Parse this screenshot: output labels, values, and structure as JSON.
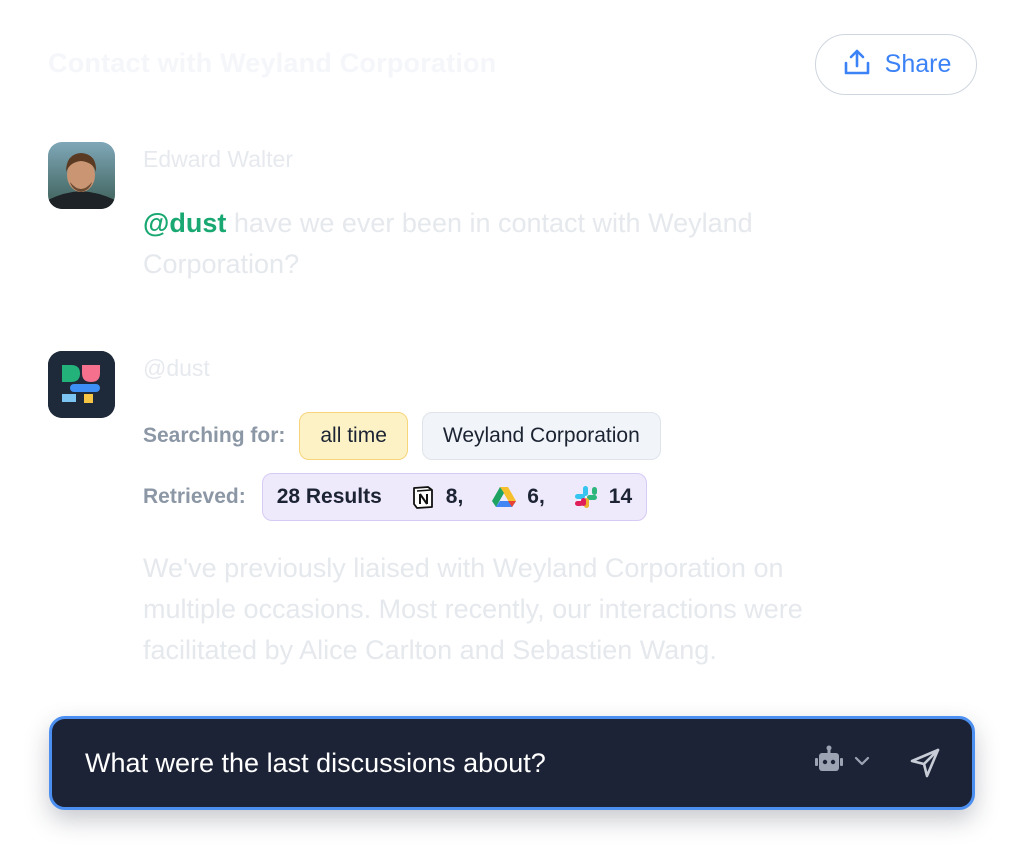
{
  "header": {
    "title": "Contact with Weyland  Corporation",
    "share_label": "Share"
  },
  "conversation": {
    "user_message": {
      "author": "Edward Walter",
      "mention": "@dust",
      "text": " have we ever been in contact with Weyland Corporation?"
    },
    "assistant_message": {
      "author": "@dust",
      "searching_label": "Searching for:",
      "search_chips": [
        "all time",
        "Weyland Corporation"
      ],
      "retrieved_label": "Retrieved:",
      "results_total": "28 Results",
      "sources": [
        {
          "icon": "notion-icon",
          "count": "8,"
        },
        {
          "icon": "google-drive-icon",
          "count": "6,"
        },
        {
          "icon": "slack-icon",
          "count": "14"
        }
      ],
      "answer": "We've previously liaised with Weyland Corporation on multiple occasions. Most recently, our interactions were facilitated by Alice Carlton and Sebastien Wang."
    }
  },
  "composer": {
    "input_value": "What were the last discussions about?",
    "agent_icon": "robot-icon",
    "send_icon": "send-icon"
  },
  "colors": {
    "accent": "#3b82f6",
    "mention": "#1aa872",
    "composer_bg": "#1c2336",
    "composer_border": "#4b8ff0"
  }
}
